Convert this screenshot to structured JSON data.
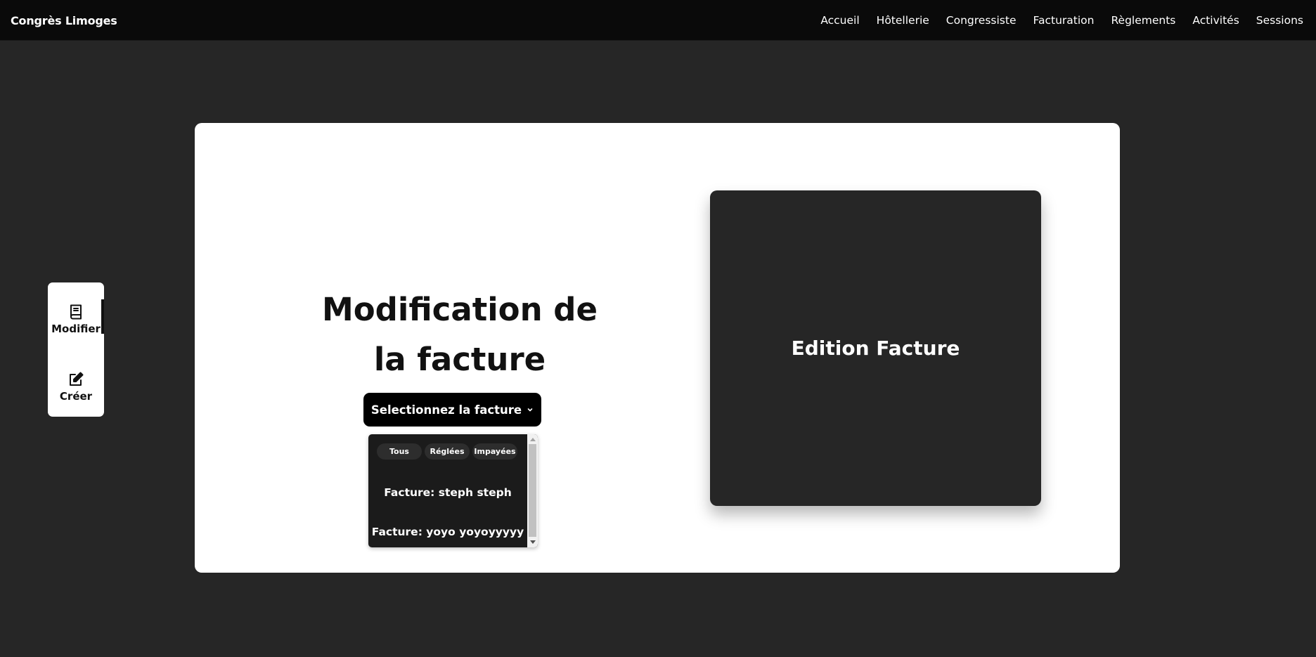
{
  "navbar": {
    "brand": "Congrès Limoges",
    "links": [
      "Accueil",
      "Hôtellerie",
      "Congressiste",
      "Facturation",
      "Règlements",
      "Activités",
      "Sessions"
    ]
  },
  "side_menu": {
    "items": [
      {
        "label": "Modifier",
        "icon": "book-icon",
        "active": true
      },
      {
        "label": "Créer",
        "icon": "edit-icon",
        "active": false
      }
    ]
  },
  "main": {
    "title_line1": "Modification de",
    "title_line2": "la facture",
    "select_label": "Selectionnez la facture",
    "dropdown": {
      "filters": [
        "Tous",
        "Réglées",
        "Impayées"
      ],
      "invoices": [
        "Facture: steph steph",
        "Facture: yoyo yoyoyyyyy"
      ]
    },
    "preview_title": "Edition Facture"
  },
  "colors": {
    "page_bg": "#262626",
    "navbar_bg": "#0a0a0a",
    "card_bg": "#ffffff",
    "dropdown_bg": "#1b1b1b",
    "accent": "#000000"
  }
}
